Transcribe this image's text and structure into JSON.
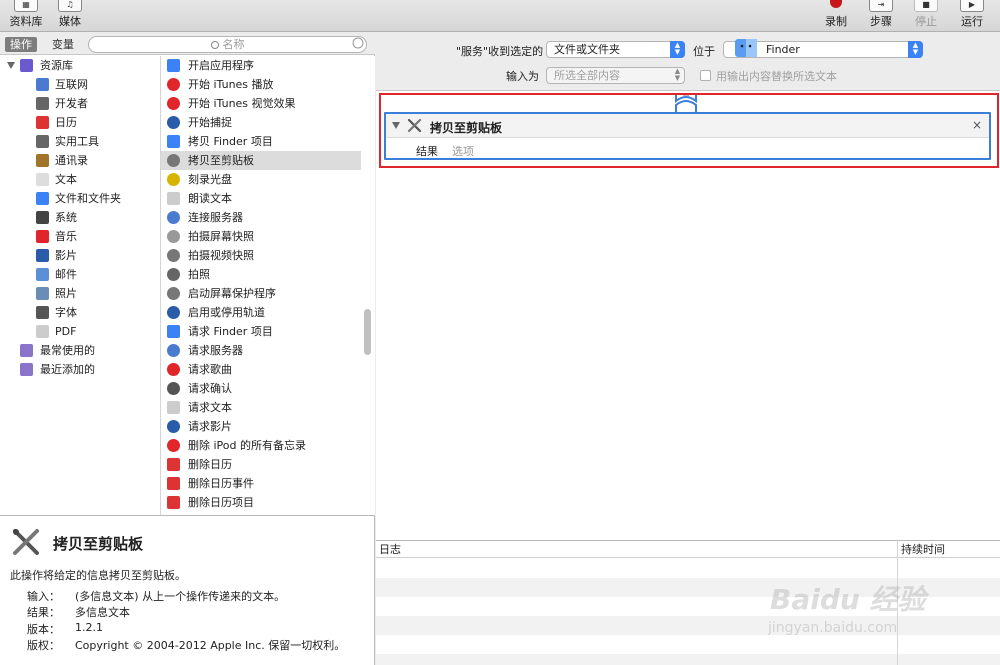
{
  "toolbar": {
    "library": "资料库",
    "media": "媒体",
    "record": "录制",
    "step": "步骤",
    "stop": "停止",
    "run": "运行"
  },
  "left": {
    "tab_actions": "操作",
    "tab_variables": "变量",
    "search_placeholder": "名称",
    "categories": [
      {
        "label": "资源库",
        "icon": "library-icon",
        "color": "#6a5acd"
      },
      {
        "label": "互联网",
        "icon": "globe-icon",
        "color": "#4a7bd0"
      },
      {
        "label": "开发者",
        "icon": "tools-icon",
        "color": "#666666"
      },
      {
        "label": "日历",
        "icon": "calendar-icon",
        "color": "#d33"
      },
      {
        "label": "实用工具",
        "icon": "tools-icon",
        "color": "#666666"
      },
      {
        "label": "通讯录",
        "icon": "contacts-icon",
        "color": "#a0752a"
      },
      {
        "label": "文本",
        "icon": "text-icon",
        "color": "#dddddd"
      },
      {
        "label": "文件和文件夹",
        "icon": "finder-icon",
        "color": "#3b82f6"
      },
      {
        "label": "系统",
        "icon": "system-icon",
        "color": "#444444"
      },
      {
        "label": "音乐",
        "icon": "music-icon",
        "color": "#e0262b"
      },
      {
        "label": "影片",
        "icon": "movie-icon",
        "color": "#2a5caa"
      },
      {
        "label": "邮件",
        "icon": "mail-icon",
        "color": "#5b8fd6"
      },
      {
        "label": "照片",
        "icon": "photo-icon",
        "color": "#6a8cb5"
      },
      {
        "label": "字体",
        "icon": "font-icon",
        "color": "#555555"
      },
      {
        "label": "PDF",
        "icon": "pdf-icon",
        "color": "#cccccc"
      },
      {
        "label": "最常使用的",
        "icon": "smart-folder-icon",
        "color": "#8a74c8"
      },
      {
        "label": "最近添加的",
        "icon": "smart-folder-icon",
        "color": "#8a74c8"
      }
    ],
    "actions": [
      {
        "label": "开启应用程序",
        "icon": "finder-icon",
        "color": "#3b82f6"
      },
      {
        "label": "开始 iTunes 播放",
        "icon": "music-icon",
        "color": "#e0262b"
      },
      {
        "label": "开始 iTunes 视觉效果",
        "icon": "music-icon",
        "color": "#e0262b"
      },
      {
        "label": "开始捕捉",
        "icon": "quicktime-icon",
        "color": "#2a5caa"
      },
      {
        "label": "拷贝 Finder 项目",
        "icon": "finder-icon",
        "color": "#3b82f6"
      },
      {
        "label": "拷贝至剪贴板",
        "icon": "tools-icon",
        "color": "#777777"
      },
      {
        "label": "刻录光盘",
        "icon": "burn-icon",
        "color": "#d6b400"
      },
      {
        "label": "朗读文本",
        "icon": "text-icon",
        "color": "#cccccc"
      },
      {
        "label": "连接服务器",
        "icon": "globe-icon",
        "color": "#4a7bd0"
      },
      {
        "label": "拍摄屏幕快照",
        "icon": "screenshot-icon",
        "color": "#999999"
      },
      {
        "label": "拍摄视频快照",
        "icon": "tools-icon",
        "color": "#777777"
      },
      {
        "label": "拍照",
        "icon": "camera-icon",
        "color": "#666666"
      },
      {
        "label": "启动屏幕保护程序",
        "icon": "tools-icon",
        "color": "#777777"
      },
      {
        "label": "启用或停用轨道",
        "icon": "quicktime-icon",
        "color": "#2a5caa"
      },
      {
        "label": "请求 Finder 项目",
        "icon": "finder-icon",
        "color": "#3b82f6"
      },
      {
        "label": "请求服务器",
        "icon": "globe-icon",
        "color": "#4a7bd0"
      },
      {
        "label": "请求歌曲",
        "icon": "music-icon",
        "color": "#e0262b"
      },
      {
        "label": "请求确认",
        "icon": "automator-icon",
        "color": "#555555"
      },
      {
        "label": "请求文本",
        "icon": "text-icon",
        "color": "#cccccc"
      },
      {
        "label": "请求影片",
        "icon": "quicktime-icon",
        "color": "#2a5caa"
      },
      {
        "label": "删除 iPod 的所有备忘录",
        "icon": "music-icon",
        "color": "#e0262b"
      },
      {
        "label": "删除日历",
        "icon": "calendar-icon",
        "color": "#d33"
      },
      {
        "label": "删除日历事件",
        "icon": "calendar-icon",
        "color": "#d33"
      },
      {
        "label": "删除日历项目",
        "icon": "calendar-icon",
        "color": "#d33"
      }
    ]
  },
  "description": {
    "title": "拷贝至剪贴板",
    "summary": "此操作将给定的信息拷贝至剪贴板。",
    "rows": [
      {
        "key": "输入：",
        "value": "(多信息文本) 从上一个操作传递来的文本。"
      },
      {
        "key": "结果：",
        "value": "多信息文本"
      },
      {
        "key": "版本：",
        "value": "1.2.1"
      },
      {
        "key": "版权：",
        "value": "Copyright © 2004-2012 Apple Inc.  保留一切权利。"
      }
    ]
  },
  "workflow": {
    "service_label": "\"服务\"收到选定的",
    "input_type": "文件或文件夹",
    "location_label": "位于",
    "location_value": "Finder",
    "input_is_label": "输入为",
    "input_is_value": "所选全部内容",
    "replace_label": "用输出内容替换所选文本",
    "action": {
      "title": "拷贝至剪贴板",
      "close": "×",
      "tab_results": "结果",
      "tab_options": "选项"
    }
  },
  "log": {
    "col_log": "日志",
    "col_duration": "持续时间"
  },
  "watermark": {
    "brand": "Baidu 经验",
    "url": "jingyan.baidu.com"
  }
}
